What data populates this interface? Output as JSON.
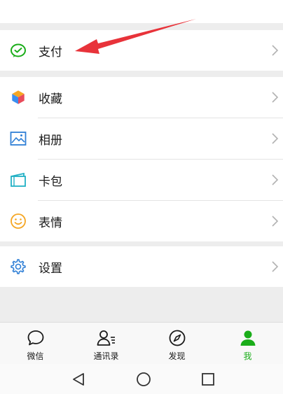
{
  "menu": {
    "payment": {
      "label": "支付",
      "icon": "wechat-pay-icon"
    },
    "group2": [
      {
        "label": "收藏",
        "icon": "favorites-cube-icon"
      },
      {
        "label": "相册",
        "icon": "album-picture-icon"
      },
      {
        "label": "卡包",
        "icon": "card-wallet-icon"
      },
      {
        "label": "表情",
        "icon": "smiley-face-icon"
      }
    ],
    "settings": {
      "label": "设置",
      "icon": "gear-icon"
    }
  },
  "tabbar": [
    {
      "label": "微信",
      "icon": "chat-bubble-icon",
      "active": false
    },
    {
      "label": "通讯录",
      "icon": "contacts-icon",
      "active": false
    },
    {
      "label": "发现",
      "icon": "compass-icon",
      "active": false
    },
    {
      "label": "我",
      "icon": "person-icon",
      "active": true
    }
  ],
  "navigation": [
    "back-triangle-icon",
    "home-circle-icon",
    "recents-square-icon"
  ],
  "colors": {
    "accent_green": "#1aad19",
    "annotation_red": "#e8333a",
    "background": "#ededed"
  }
}
